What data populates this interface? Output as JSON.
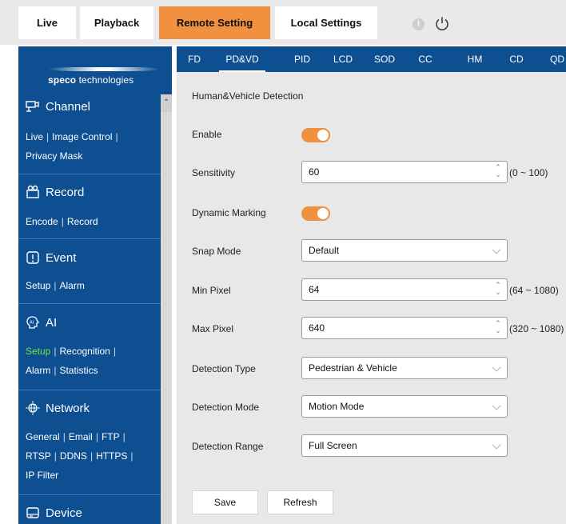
{
  "top_tabs": [
    "Live",
    "Playback",
    "Remote Setting",
    "Local Settings"
  ],
  "icons": {
    "warning": "warning-icon",
    "power": "power-icon"
  },
  "colors": {
    "accent": "#f1903f",
    "sidebar": "#0e4f92",
    "panel": "#e8e8e8",
    "active_link": "#6fe34a"
  },
  "logo": {
    "brand_bold": "speco",
    "brand_rest": " technologies"
  },
  "sidebar": {
    "channel": {
      "title": "Channel",
      "links": [
        "Live",
        "Image Control",
        "Privacy Mask"
      ]
    },
    "record": {
      "title": "Record",
      "links": [
        "Encode",
        "Record"
      ]
    },
    "event": {
      "title": "Event",
      "links": [
        "Setup",
        "Alarm"
      ]
    },
    "ai": {
      "title": "AI",
      "links": [
        "Setup",
        "Recognition",
        "Alarm",
        "Statistics"
      ],
      "active": "Setup"
    },
    "network": {
      "title": "Network",
      "links": [
        "General",
        "Email",
        "FTP",
        "RTSP",
        "DDNS",
        "HTTPS",
        "IP Filter"
      ]
    },
    "device": {
      "title": "Device"
    }
  },
  "sub_tabs": [
    "FD",
    "PD&VD",
    "PID",
    "LCD",
    "SOD",
    "CC",
    "HM",
    "CD",
    "QD"
  ],
  "active_sub_tab": "PD&VD",
  "form": {
    "title": "Human&Vehicle Detection",
    "enable_label": "Enable",
    "enable_on": true,
    "sensitivity_label": "Sensitivity",
    "sensitivity_value": "60",
    "sensitivity_range": "(0 ~ 100)",
    "dynamic_marking_label": "Dynamic Marking",
    "dynamic_marking_on": true,
    "snap_mode_label": "Snap Mode",
    "snap_mode_value": "Default",
    "min_pixel_label": "Min Pixel",
    "min_pixel_value": "64",
    "min_pixel_range": "(64 ~ 1080)",
    "max_pixel_label": "Max Pixel",
    "max_pixel_value": "640",
    "max_pixel_range": "(320 ~ 1080)",
    "detection_type_label": "Detection Type",
    "detection_type_value": "Pedestrian & Vehicle",
    "detection_mode_label": "Detection Mode",
    "detection_mode_value": "Motion Mode",
    "detection_range_label": "Detection Range",
    "detection_range_value": "Full Screen"
  },
  "buttons": {
    "save": "Save",
    "refresh": "Refresh"
  }
}
